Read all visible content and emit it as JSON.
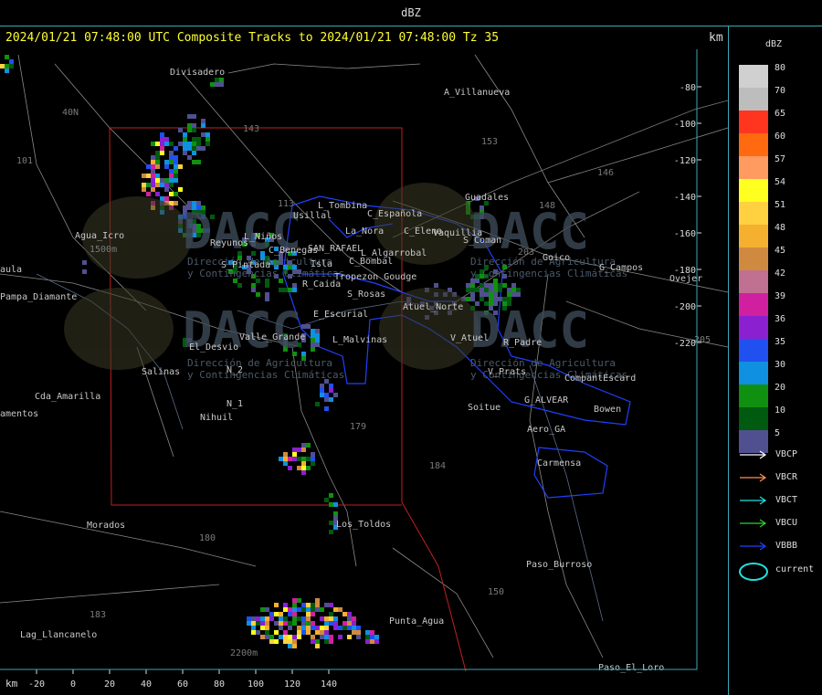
{
  "window_title": "dBZ",
  "subtitle": "2024/01/21 07:48:00 UTC Composite Tracks to 2024/01/21 07:48:00 Tz 35",
  "km_label": "km",
  "legend": {
    "title": "dBZ",
    "scale": [
      {
        "value": "80",
        "color": "#d0d0d0"
      },
      {
        "value": "70",
        "color": "#bdbdbd"
      },
      {
        "value": "65",
        "color": "#ff3520"
      },
      {
        "value": "60",
        "color": "#ff6a10"
      },
      {
        "value": "57",
        "color": "#ff9a60"
      },
      {
        "value": "54",
        "color": "#ffff20"
      },
      {
        "value": "51",
        "color": "#ffd040"
      },
      {
        "value": "48",
        "color": "#f5b030"
      },
      {
        "value": "45",
        "color": "#d08a40"
      },
      {
        "value": "42",
        "color": "#c07090"
      },
      {
        "value": "39",
        "color": "#d020a0"
      },
      {
        "value": "36",
        "color": "#8a20d0"
      },
      {
        "value": "35",
        "color": "#2050f0"
      },
      {
        "value": "30",
        "color": "#1090e0"
      },
      {
        "value": "20",
        "color": "#109010"
      },
      {
        "value": "10",
        "color": "#005a10"
      },
      {
        "value": "5",
        "color": "#505090"
      }
    ],
    "tracks": [
      {
        "label": "VBCP",
        "color": "#ffffff"
      },
      {
        "label": "VBCR",
        "color": "#ff9050"
      },
      {
        "label": "VBCT",
        "color": "#20e0e0"
      },
      {
        "label": "VBCU",
        "color": "#30d030"
      },
      {
        "label": "VBBB",
        "color": "#2040ff"
      }
    ],
    "current_label": "current"
  },
  "axes": {
    "x_unit": "km",
    "x_ticks": [
      "-20",
      "0",
      "20",
      "40",
      "60",
      "80",
      "100",
      "120",
      "140"
    ],
    "y_ticks": [
      "-80",
      "-100",
      "-120",
      "-140",
      "-160",
      "-180",
      "-200",
      "-220"
    ]
  },
  "places": [
    "Divisadero",
    "A_Villanueva",
    "Guadales",
    "L_Tombina",
    "C_Española",
    "Usillal",
    "La_Nora",
    "C_Elena",
    "Vaquillia",
    "S_Coman",
    "Reyunos",
    "L_Niños",
    "C_Benegas",
    "SAN_RAFAEL",
    "L_Algarrobal",
    "C_Bombal",
    "Goico",
    "G_Campos",
    "S_Pintada",
    "Isla",
    "Tropezon Goudge",
    "R_Caida",
    "S_Rosas",
    "Atuel_Norte",
    "E_Escurial",
    "L_Malvinas",
    "V_Atuel",
    "R_Padre",
    "Valle_Grande",
    "El_Desvio",
    "Salinas",
    "V_Prats",
    "CompantEscard",
    "N_2",
    "G_ALVEAR",
    "N_1",
    "Bowen",
    "Soitue",
    "Nihuil",
    "Aero_GA",
    "Carmensa",
    "Cda_Amarilla",
    "Agua_Icro",
    "Pampa_Diamante",
    "Morados",
    "Los_Toldos",
    "Paso_Burroso",
    "Punta_Agua",
    "Lag_Llancanelo",
    "Paso_El_Loro",
    "Ovejer",
    "aula",
    "amentos",
    "153",
    "146",
    "148",
    "203",
    "205",
    "143",
    "113",
    "179",
    "184",
    "180",
    "183",
    "150",
    "101",
    "40N",
    "2200m",
    "1500m"
  ],
  "watermark": {
    "brand": "DACC",
    "line1": "Dirección de Agricultura",
    "line2": "y Contingencias Climáticas"
  }
}
